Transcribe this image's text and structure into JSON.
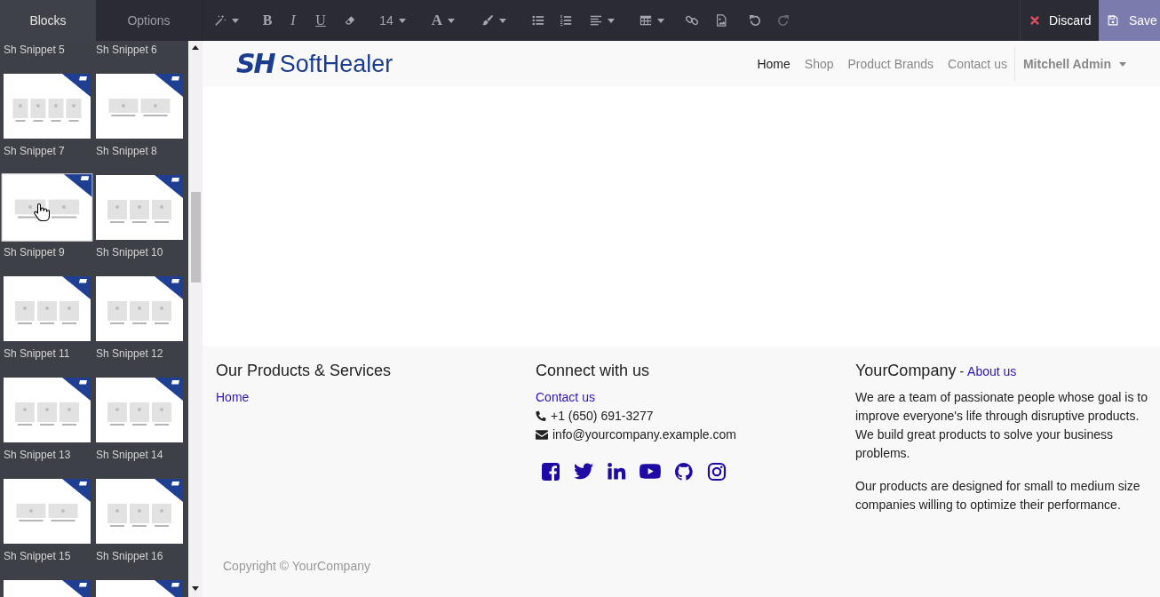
{
  "sidebar": {
    "tabs": [
      {
        "label": "Blocks",
        "selected": true
      },
      {
        "label": "Options",
        "selected": false
      }
    ],
    "snippets": [
      {
        "kind": "caption",
        "label": "Sh Snippet 5",
        "hovered": false
      },
      {
        "kind": "caption",
        "label": "Sh Snippet 6",
        "hovered": false
      },
      {
        "kind": "full",
        "label": "Sh Snippet 7",
        "hovered": false
      },
      {
        "kind": "full",
        "label": "Sh Snippet 8",
        "hovered": false
      },
      {
        "kind": "full",
        "label": "Sh Snippet 9",
        "hovered": true
      },
      {
        "kind": "full",
        "label": "Sh Snippet 10",
        "hovered": false
      },
      {
        "kind": "full",
        "label": "Sh Snippet 11",
        "hovered": false
      },
      {
        "kind": "full",
        "label": "Sh Snippet 12",
        "hovered": false
      },
      {
        "kind": "full",
        "label": "Sh Snippet 13",
        "hovered": false
      },
      {
        "kind": "full",
        "label": "Sh Snippet 14",
        "hovered": false
      },
      {
        "kind": "full",
        "label": "Sh Snippet 15",
        "hovered": false
      },
      {
        "kind": "full",
        "label": "Sh Snippet 16",
        "hovered": false
      },
      {
        "kind": "preview",
        "hovered": false
      },
      {
        "kind": "preview",
        "hovered": false
      }
    ]
  },
  "toolbar": {
    "bold": "B",
    "italic": "I",
    "underline": "U",
    "font_size": "14",
    "font_color": "A",
    "undo": {
      "disabled": false
    },
    "redo": {
      "disabled": true
    }
  },
  "actions": [
    {
      "kind": "discard",
      "label": "Discard"
    },
    {
      "kind": "save",
      "label": "Save"
    }
  ],
  "header": {
    "logo": {
      "mark": "SH",
      "name": "SoftHealer"
    },
    "menu": [
      {
        "label": "Home",
        "selected": true
      },
      {
        "label": "Shop",
        "selected": false
      },
      {
        "label": "Product Brands",
        "selected": false
      },
      {
        "label": "Contact us",
        "selected": false
      }
    ],
    "user": "Mitchell Admin"
  },
  "footer": {
    "products": {
      "title": "Our Products & Services",
      "links": [
        "Home"
      ]
    },
    "connect": {
      "title": "Connect with us",
      "link": "Contact us",
      "phone": "+1 (650) 691-3277",
      "email": "info@yourcompany.example.com"
    },
    "about": {
      "title": "YourCompany",
      "separator": "-",
      "link": "About us",
      "paragraphs": [
        "We are a team of passionate people whose goal is to improve everyone's life through disruptive products. We build great products to solve your business problems.",
        "Our products are designed for small to medium size companies willing to optimize their performance."
      ]
    },
    "copyright": "Copyright © YourCompany"
  }
}
